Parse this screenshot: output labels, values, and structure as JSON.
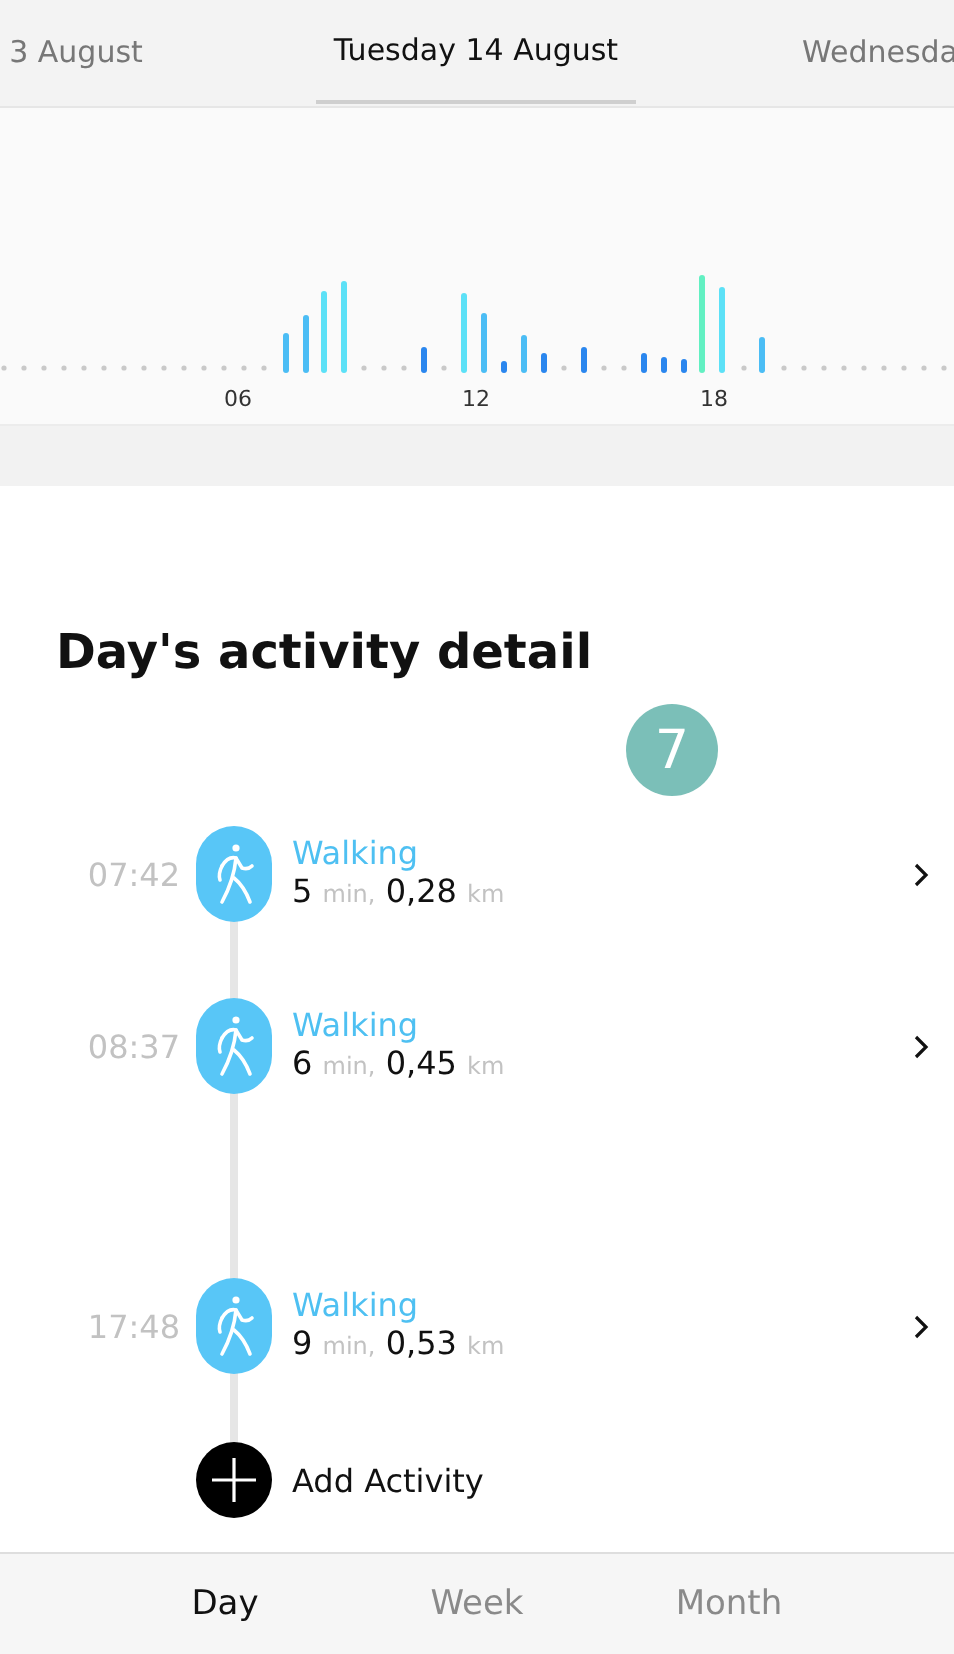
{
  "date_tabs": [
    {
      "label": "3 August",
      "selected": false
    },
    {
      "label": "Tuesday 14 August",
      "selected": true
    },
    {
      "label": "Wednesda",
      "selected": false
    }
  ],
  "activity_chart": {
    "axis_labels": [
      "06",
      "12",
      "18"
    ]
  },
  "detail": {
    "title": "Day's activity detail",
    "badge": "7",
    "activities": [
      {
        "time": "07:42",
        "name": "Walking",
        "duration": "5",
        "duration_unit": "min,",
        "distance": "0,28",
        "distance_unit": "km"
      },
      {
        "time": "08:37",
        "name": "Walking",
        "duration": "6",
        "duration_unit": "min,",
        "distance": "0,45",
        "distance_unit": "km"
      },
      {
        "time": "17:48",
        "name": "Walking",
        "duration": "9",
        "duration_unit": "min,",
        "distance": "0,53",
        "distance_unit": "km"
      }
    ],
    "add_label": "Add Activity"
  },
  "bottom_tabs": [
    {
      "label": "Day",
      "selected": true
    },
    {
      "label": "Week",
      "selected": false
    },
    {
      "label": "Month",
      "selected": false
    }
  ]
}
